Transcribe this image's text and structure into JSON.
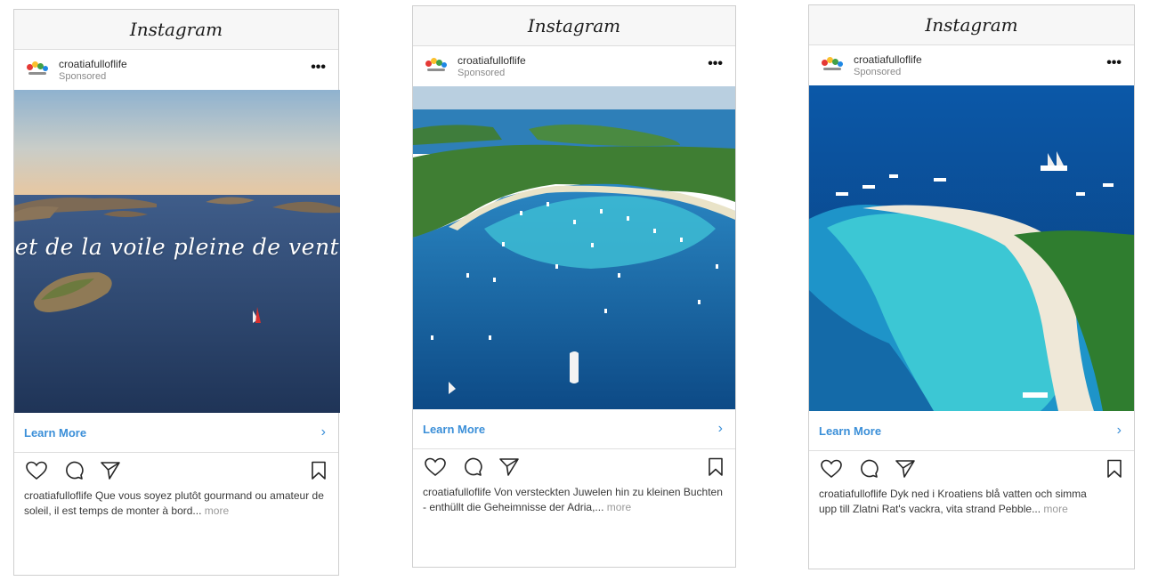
{
  "app": {
    "logo_text": "Instagram"
  },
  "cards": [
    {
      "account": "croatiafulloflife",
      "sponsored": "Sponsored",
      "image_overlay": "et de la voile pleine de vent",
      "cta": "Learn More",
      "caption_user": "croatiafulloflife",
      "caption_text": " Que vous soyez plutôt gourmand ou amateur de soleil, il est temps de monter à bord...",
      "caption_more": "more"
    },
    {
      "account": "croatiafulloflife",
      "sponsored": "Sponsored",
      "cta": "Learn More",
      "caption_user": "croatiafulloflife",
      "caption_text": " Von versteckten Juwelen hin zu kleinen Buchten - enthüllt die Geheimnisse der Adria,...",
      "caption_more": "more"
    },
    {
      "account": "croatiafulloflife",
      "sponsored": "Sponsored",
      "cta": "Learn More",
      "caption_user": "croatiafulloflife",
      "caption_text_line1": " Dyk ned i Kroatiens blå vatten och simma",
      "caption_text_line2": "upp till Zlatni Rat's vackra, vita strand Pebble...",
      "caption_more": "more"
    }
  ],
  "icons": [
    "heart-icon",
    "comment-icon",
    "share-icon",
    "bookmark-icon",
    "chevron-right-icon",
    "more-icon"
  ],
  "colors": {
    "link_blue": "#3b8fd8",
    "border": "#cfcfcf"
  }
}
